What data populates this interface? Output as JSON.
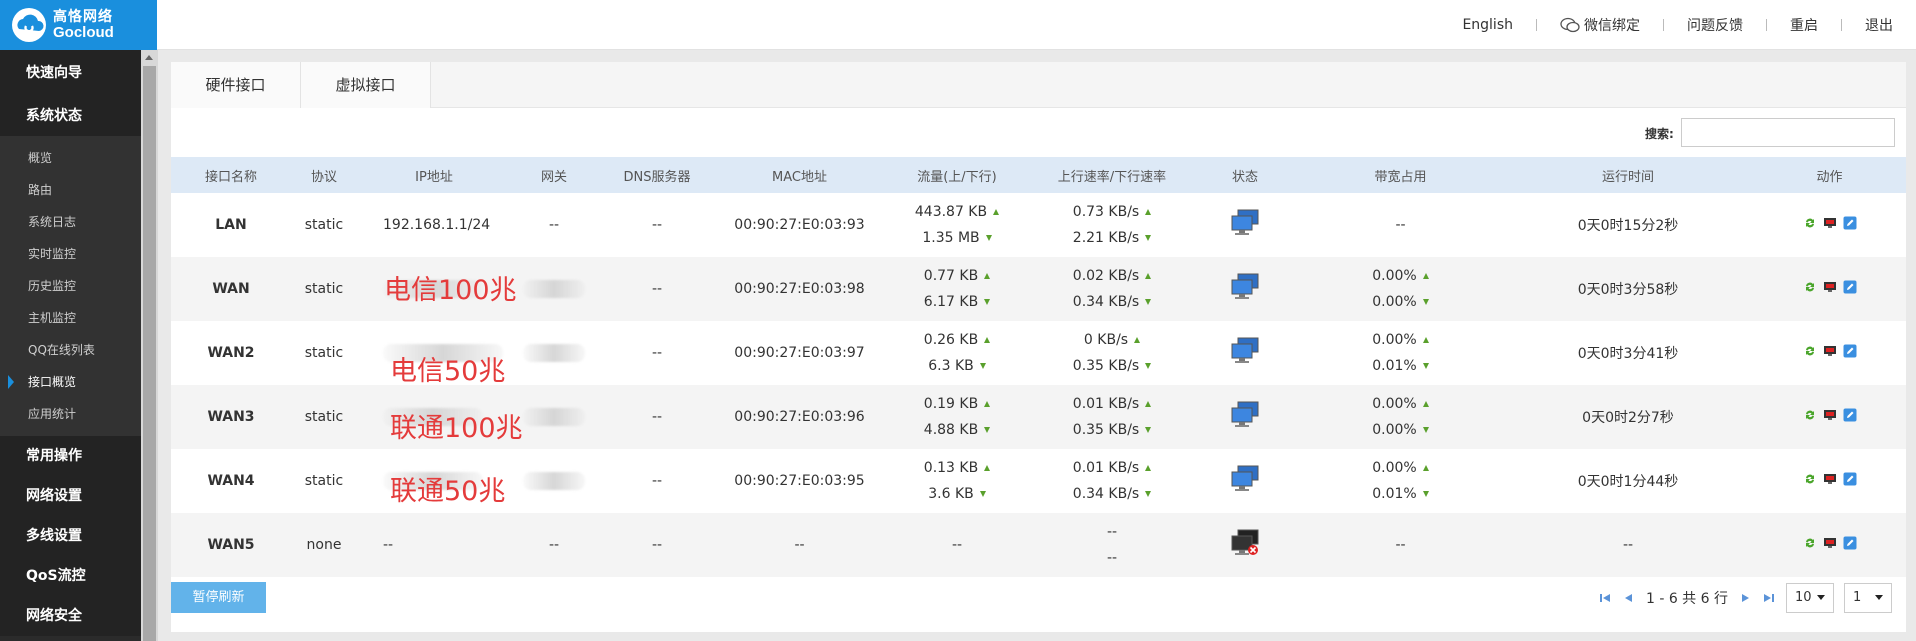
{
  "brand": {
    "cn": "高恪网络",
    "en": "Gocloud"
  },
  "topnav": {
    "lang": "English",
    "wechat": "微信绑定",
    "feedback": "问题反馈",
    "reboot": "重启",
    "logout": "退出"
  },
  "sidebar": {
    "groups": [
      "快速向导",
      "系统状态",
      "常用操作",
      "网络设置",
      "多线设置",
      "QoS流控",
      "网络安全"
    ],
    "items": [
      "概览",
      "路由",
      "系统日志",
      "实时监控",
      "历史监控",
      "主机监控",
      "QQ在线列表",
      "接口概览",
      "应用统计"
    ]
  },
  "tabs": [
    "硬件接口",
    "虚拟接口"
  ],
  "search": {
    "label": "搜索:",
    "value": ""
  },
  "table": {
    "headers": [
      "接口名称",
      "协议",
      "IP地址",
      "网关",
      "DNS服务器",
      "MAC地址",
      "流量(上/下行)",
      "上行速率/下行速率",
      "状态",
      "带宽占用",
      "运行时间",
      "动作"
    ],
    "rows": [
      {
        "name": "LAN",
        "proto": "static",
        "ip": "192.168.1.1/24",
        "gw": "--",
        "dns": "--",
        "mac": "00:90:27:E0:03:93",
        "traffic_up": "443.87 KB",
        "traffic_dn": "1.35 MB",
        "rate_up": "0.73 KB/s",
        "rate_dn": "2.21 KB/s",
        "bw_up": "",
        "bw_dn": "",
        "bw": "--",
        "uptime": "0天0时15分2秒"
      },
      {
        "name": "WAN",
        "proto": "static",
        "ip": "",
        "gw": "",
        "dns": "--",
        "mac": "00:90:27:E0:03:98",
        "traffic_up": "0.77 KB",
        "traffic_dn": "6.17 KB",
        "rate_up": "0.02 KB/s",
        "rate_dn": "0.34 KB/s",
        "bw_up": "0.00%",
        "bw_dn": "0.00%",
        "bw": "",
        "uptime": "0天0时3分58秒"
      },
      {
        "name": "WAN2",
        "proto": "static",
        "ip": "",
        "gw": "",
        "dns": "--",
        "mac": "00:90:27:E0:03:97",
        "traffic_up": "0.26 KB",
        "traffic_dn": "6.3 KB",
        "rate_up": "0 KB/s",
        "rate_dn": "0.35 KB/s",
        "bw_up": "0.00%",
        "bw_dn": "0.01%",
        "bw": "",
        "uptime": "0天0时3分41秒"
      },
      {
        "name": "WAN3",
        "proto": "static",
        "ip": "",
        "gw": "",
        "dns": "--",
        "mac": "00:90:27:E0:03:96",
        "traffic_up": "0.19 KB",
        "traffic_dn": "4.88 KB",
        "rate_up": "0.01 KB/s",
        "rate_dn": "0.35 KB/s",
        "bw_up": "0.00%",
        "bw_dn": "0.00%",
        "bw": "",
        "uptime": "0天0时2分7秒"
      },
      {
        "name": "WAN4",
        "proto": "static",
        "ip": "",
        "gw": "",
        "dns": "--",
        "mac": "00:90:27:E0:03:95",
        "traffic_up": "0.13 KB",
        "traffic_dn": "3.6 KB",
        "rate_up": "0.01 KB/s",
        "rate_dn": "0.34 KB/s",
        "bw_up": "0.00%",
        "bw_dn": "0.01%",
        "bw": "",
        "uptime": "0天0时1分44秒"
      },
      {
        "name": "WAN5",
        "proto": "none",
        "ip": "--",
        "gw": "--",
        "dns": "--",
        "mac": "--",
        "traffic": "--",
        "rate_up": "--",
        "rate_dn": "--",
        "bw": "--",
        "uptime": "--"
      }
    ]
  },
  "annotations": [
    "电信100兆",
    "电信50兆",
    "联通100兆",
    "联通50兆"
  ],
  "footer": {
    "pause": "暂停刷新",
    "range": "1 - 6 共 6 行",
    "page_size": "10",
    "page": "1"
  },
  "colors": {
    "brand": "#1a8fdd",
    "header_row": "#dde9f6",
    "annotation": "#e43b3b",
    "arrow": "#5aa02c"
  }
}
